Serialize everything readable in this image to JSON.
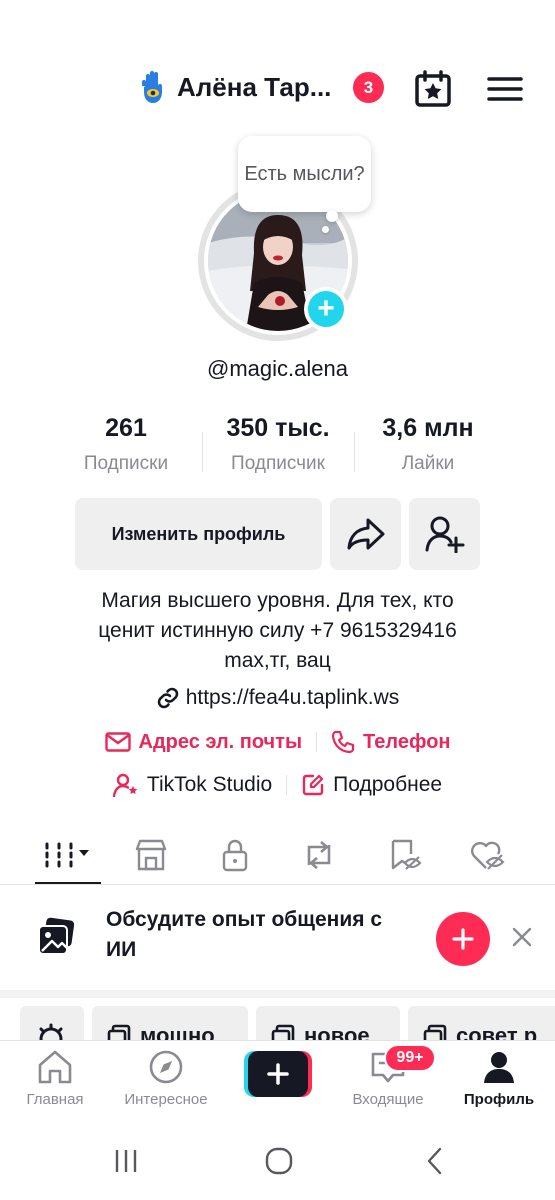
{
  "header": {
    "username": "Алёна Тар...",
    "notification_count": "3",
    "icons": [
      "hamsa-icon",
      "calendar-star-icon",
      "menu-icon"
    ]
  },
  "profile": {
    "thought_bubble": "Есть мысли?",
    "handle": "@magic.alena",
    "stats": [
      {
        "value": "261",
        "label": "Подписки"
      },
      {
        "value": "350 тыс.",
        "label": "Подписчик"
      },
      {
        "value": "3,6 млн",
        "label": "Лайки"
      }
    ],
    "edit_button": "Изменить профиль",
    "bio_line1": "Магия высшего уровня. Для тех, кто",
    "bio_line2": "ценит истинную силу +7 9615329416",
    "bio_line3": "max,тг, вац",
    "link": "https://fea4u.taplink.ws",
    "email_label": "Адрес эл. почты",
    "phone_label": "Телефон",
    "studio_label": "TikTok Studio",
    "more_label": "Подробнее"
  },
  "tabs": [
    "videos-grid",
    "shop",
    "private",
    "reposts",
    "favorites",
    "liked"
  ],
  "promo": {
    "text": "Обсудите опыт общения с ИИ"
  },
  "chips": [
    {
      "label": ""
    },
    {
      "label": "мощно"
    },
    {
      "label": "новое"
    },
    {
      "label": "совет р"
    }
  ],
  "bottom_nav": {
    "home": "Главная",
    "discover": "Интересное",
    "inbox": "Входящие",
    "inbox_badge": "99+",
    "profile": "Профиль"
  },
  "colors": {
    "accent": "#fe2c55",
    "cyan": "#20d5ec",
    "link_red": "#e8285a",
    "muted": "#8a8b91",
    "button_bg": "#efefef"
  }
}
